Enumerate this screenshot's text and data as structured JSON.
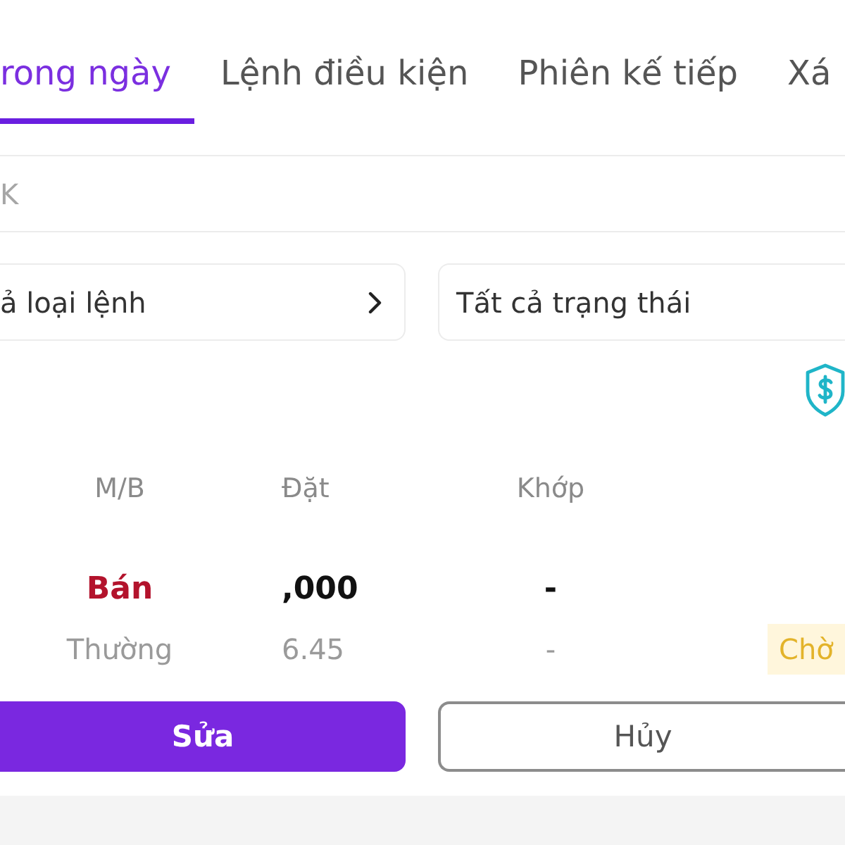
{
  "tabs": [
    {
      "label": "rong ngày",
      "selected": true
    },
    {
      "label": "Lệnh điều kiện",
      "selected": false
    },
    {
      "label": "Phiên kế tiếp",
      "selected": false
    },
    {
      "label": "Xá",
      "selected": false
    }
  ],
  "search": {
    "placeholder": "K"
  },
  "filters": [
    {
      "kind": "select",
      "value": "ả loại lệnh"
    },
    {
      "kind": "text",
      "value": "Tất cả trạng thái"
    }
  ],
  "table": {
    "columns": [
      "M/B",
      "Đặt",
      "Khớp"
    ]
  },
  "order": {
    "side": {
      "label": "Bán",
      "kind": "sell"
    },
    "quantity": ",000",
    "matched_quantity": "-",
    "order_type": "Thường",
    "price": "6.45",
    "matched_price": "-",
    "status": {
      "label": "Chờ",
      "kind": "pending"
    }
  },
  "buttons": [
    {
      "label": "Sửa",
      "kind": "primary"
    },
    {
      "label": "Hủy",
      "kind": "outline"
    }
  ]
}
